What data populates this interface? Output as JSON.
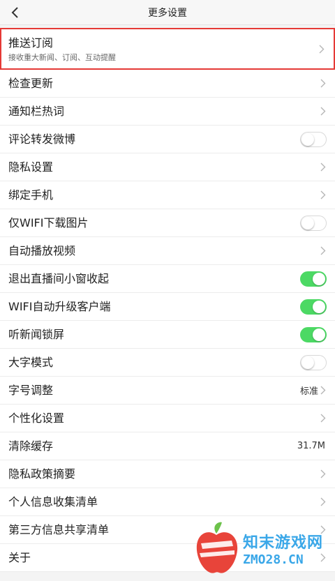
{
  "header": {
    "title": "更多设置",
    "back_icon": "chevron-left-icon"
  },
  "rows": [
    {
      "label": "推送订阅",
      "sub": "接收重大新闻、订阅、互动提醒",
      "type": "chevron"
    },
    {
      "label": "检查更新",
      "type": "chevron"
    },
    {
      "label": "通知栏热词",
      "type": "chevron"
    },
    {
      "label": "评论转发微博",
      "type": "toggle",
      "on": false
    },
    {
      "label": "隐私设置",
      "type": "chevron"
    },
    {
      "label": "绑定手机",
      "type": "chevron"
    },
    {
      "label": "仅WIFI下载图片",
      "type": "toggle",
      "on": false
    },
    {
      "label": "自动播放视频",
      "type": "chevron"
    },
    {
      "label": "退出直播间小窗收起",
      "type": "toggle",
      "on": true
    },
    {
      "label": "WIFI自动升级客户端",
      "type": "toggle",
      "on": true
    },
    {
      "label": "听新闻锁屏",
      "type": "toggle",
      "on": true
    },
    {
      "label": "大字模式",
      "type": "toggle",
      "on": false
    },
    {
      "label": "字号调整",
      "type": "value-chevron",
      "value": "标准"
    },
    {
      "label": "个性化设置",
      "type": "chevron"
    },
    {
      "label": "清除缓存",
      "type": "value",
      "value": "31.7M"
    },
    {
      "label": "隐私政策摘要",
      "type": "chevron"
    },
    {
      "label": "个人信息收集清单",
      "type": "chevron"
    },
    {
      "label": "第三方信息共享清单",
      "type": "chevron"
    },
    {
      "label": "关于",
      "type": "chevron"
    }
  ],
  "watermark": {
    "title": "知末游戏网",
    "url": "ZMO28.CN"
  },
  "colors": {
    "toggle_on": "#4cd964",
    "highlight_border": "#e53935",
    "watermark": "#3aa7e8"
  }
}
